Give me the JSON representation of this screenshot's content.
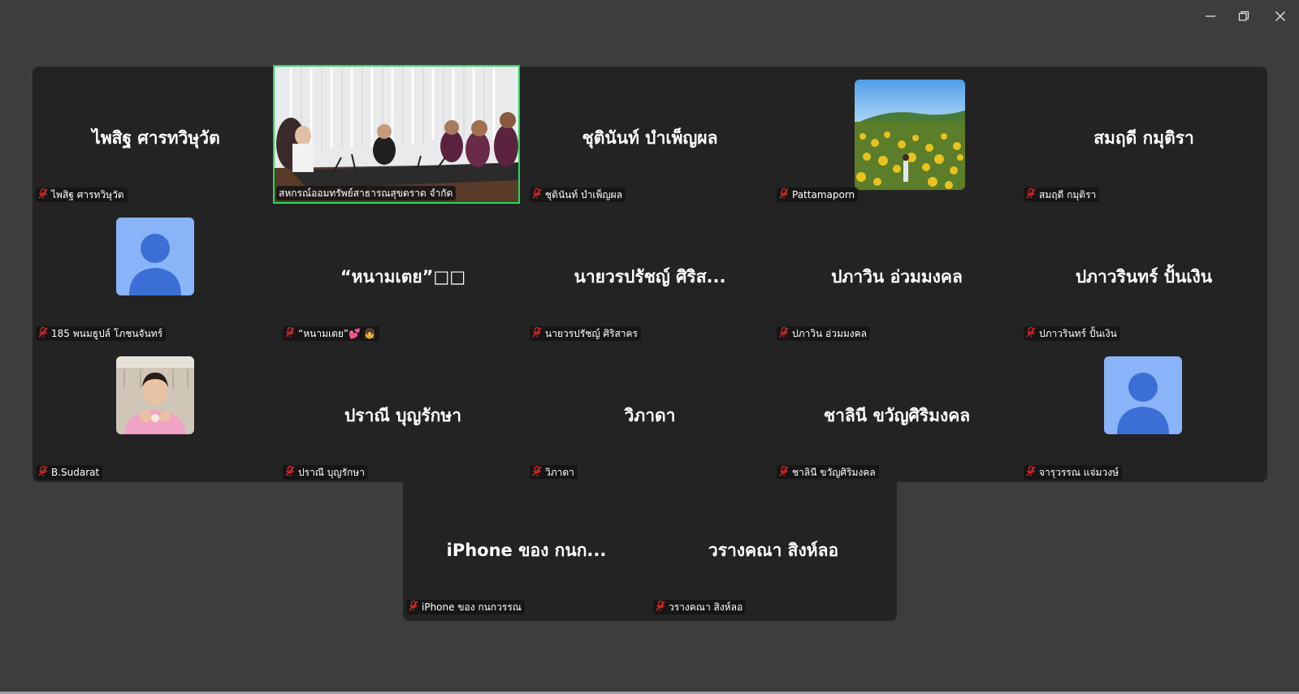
{
  "participants": [
    {
      "display": "ไพสิฐ ศารทวิษุวัต",
      "tag": "ไพสิฐ ศารทวิษุวัต"
    },
    {
      "display": "",
      "tag": "สหกรณ์ออมทรัพย์สาธารณสุขตราด จำกัด"
    },
    {
      "display": "ชุตินันท์ บำเพ็ญผล",
      "tag": "ชุตินันท์ บำเพ็ญผล"
    },
    {
      "display": "",
      "tag": "Pattamaporn"
    },
    {
      "display": "สมฤดี กมุติรา",
      "tag": "สมฤดี กมุติรา"
    },
    {
      "display": "",
      "tag": "185 พนมธูปล์ โภชนจันทร์"
    },
    {
      "display": "“หนามเตย”□□",
      "tag": "“หนามเตย”💕 👧"
    },
    {
      "display": "นายวรปรัชญ์ ศิริส...",
      "tag": "นายวรปรัชญ์ ศิริสาคร"
    },
    {
      "display": "ปภาวิน อ่วมมงคล",
      "tag": "ปภาวิน อ่วมมงคล"
    },
    {
      "display": "ปภาวรินทร์ ปั้นเงิน",
      "tag": "ปภาวรินทร์ ปั้นเงิน"
    },
    {
      "display": "",
      "tag": "B.Sudarat"
    },
    {
      "display": "ปราณี บุญรักษา",
      "tag": "ปราณี บุญรักษา"
    },
    {
      "display": "วิภาดา",
      "tag": "วิภาดา"
    },
    {
      "display": "ชาลินี ขวัญศิริมงคล",
      "tag": "ชาลินี ขวัญศิริมงคล"
    },
    {
      "display": "",
      "tag": "จารุวรรณ แจ่มวงษ์"
    },
    {
      "display": "iPhone ของ กนก...",
      "tag": "iPhone ของ กนกวรรณ"
    },
    {
      "display": "วรางคณา สิงห์ลอ",
      "tag": "วรางคณา สิงห์ลอ"
    }
  ],
  "icons": {
    "minimize": "minimize-icon",
    "restore": "restore-icon",
    "close": "close-icon",
    "mic_muted": "mic-muted-icon",
    "avatar": "default-avatar-icon"
  },
  "colors": {
    "active_speaker_border": "#23d959",
    "mute_icon": "#e02828",
    "avatar_bg": "#8ab4f8",
    "avatar_fg": "#3b6fd6"
  }
}
